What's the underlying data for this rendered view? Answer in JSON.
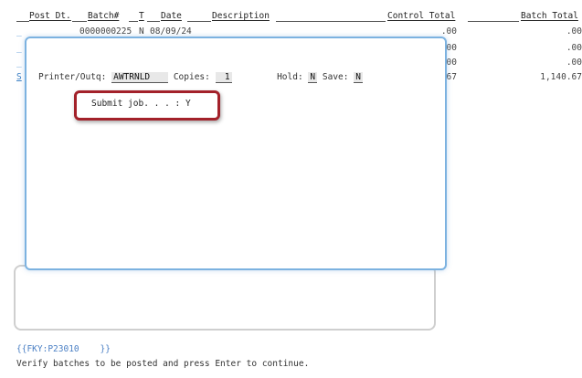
{
  "header": {
    "post_dt": "Post Dt.",
    "batch": "Batch#",
    "t": "T",
    "date": "Date",
    "description": "Description",
    "control_total": "Control Total",
    "batch_total": "Batch Total"
  },
  "rows": [
    {
      "marker": "_",
      "batch": "0000000225",
      "t": "N",
      "date": "08/09/24",
      "control_total": ".00",
      "batch_total": ".00"
    },
    {
      "marker": "_",
      "control_total": "00",
      "batch_total": ".00"
    },
    {
      "marker": "_",
      "control_total": "00",
      "batch_total": ".00"
    },
    {
      "marker": "S",
      "control_total": "67",
      "batch_total": "1,140.67"
    }
  ],
  "popup": {
    "printer_label": "Printer/Outq:",
    "printer_value": "AWTRNLD",
    "copies_label": "Copies:",
    "copies_value": "1",
    "hold_label": "Hold:",
    "hold_value": "N",
    "save_label": "Save:",
    "save_value": "N",
    "submit_label": "Submit job. . . :",
    "submit_value": "Y"
  },
  "footer": {
    "fky": "{{FKY:P23010    }}",
    "instruction": "Verify batches to be posted and press Enter to continue."
  },
  "colors": {
    "popup_border": "#7cb2e0",
    "highlight_border": "#a3212a",
    "link_blue": "#4a7fc4"
  }
}
